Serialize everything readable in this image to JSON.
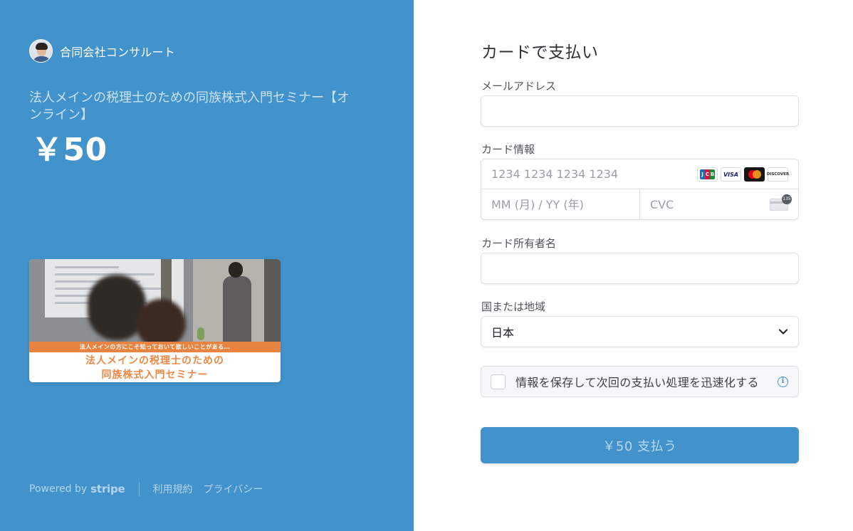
{
  "merchant": {
    "name": "合同会社コンサルート"
  },
  "product": {
    "name": "法人メインの税理士のための同族株式入門セミナー【オンライン】",
    "price": "￥50",
    "image": {
      "ribbon_text": "法人メインの方にこそ知っておいて欲しいことがある…",
      "banner_line1": "法人メインの税理士のための",
      "banner_line2": "同族株式入門セミナー"
    }
  },
  "footer": {
    "powered_by": "Powered by",
    "stripe": "stripe",
    "terms": "利用規約",
    "privacy": "プライバシー"
  },
  "form": {
    "title": "カードで支払い",
    "email_label": "メールアドレス",
    "email_value": "",
    "card_label": "カード情報",
    "card_number_placeholder": "1234 1234 1234 1234",
    "expiry_placeholder": "MM (月) / YY (年)",
    "cvc_placeholder": "CVC",
    "cvc_badge": "135",
    "card_brands": [
      "JCB",
      "VISA",
      "Mastercard",
      "DISCOVER"
    ],
    "holder_label": "カード所有者名",
    "holder_value": "",
    "country_label": "国または地域",
    "country_value": "日本",
    "save_info_text": "情報を保存して次回の支払い処理を迅速化する",
    "pay_button": "￥50 支払う"
  },
  "colors": {
    "brand": "#4293cc",
    "info": "#4a8fd6"
  }
}
